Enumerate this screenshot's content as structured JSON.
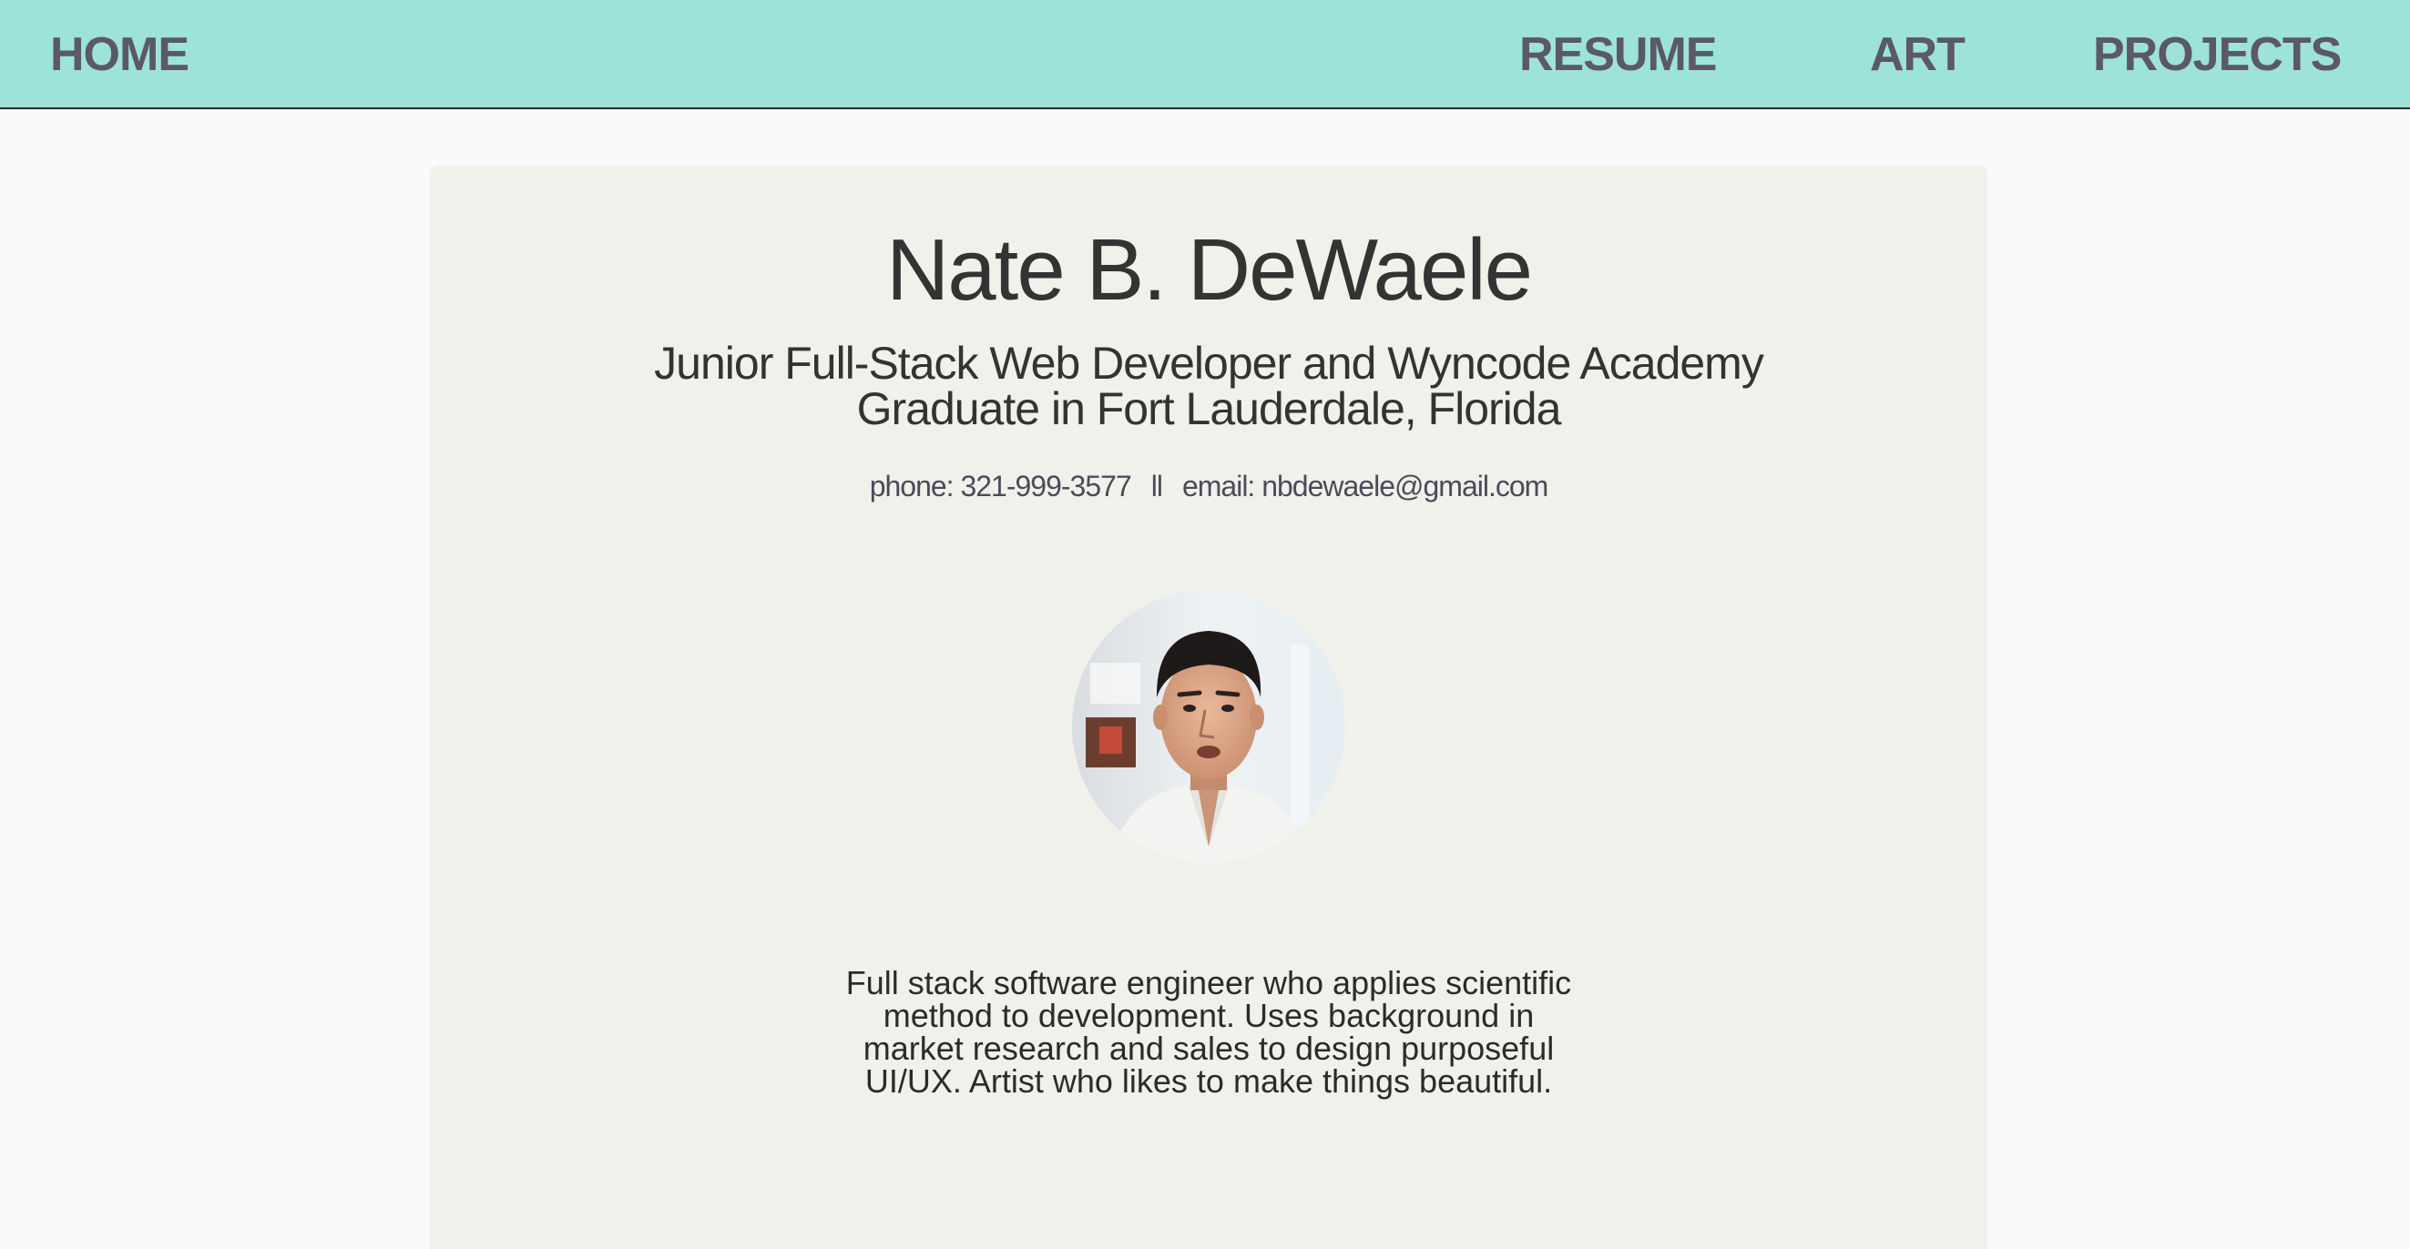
{
  "nav": {
    "home": "HOME",
    "resume": "RESUME",
    "art": "ART",
    "projects": "PROJECTS"
  },
  "profile": {
    "name": "Nate B. DeWaele",
    "subtitle": "Junior Full-Stack Web Developer and Wyncode Academy Graduate in Fort Lauderdale, Florida",
    "phone": "phone: 321-999-3577",
    "separator": "ll",
    "email": "email: nbdewaele@gmail.com",
    "bio": "Full stack software engineer who applies scientific method to development. Uses background in market research and sales to design purposeful UI/UX. Artist who likes to make things beautiful."
  },
  "colors": {
    "navbar": "#9de3d8",
    "nav_text": "#5b5867",
    "card": "#f1f1eb",
    "page": "#fafafa"
  }
}
